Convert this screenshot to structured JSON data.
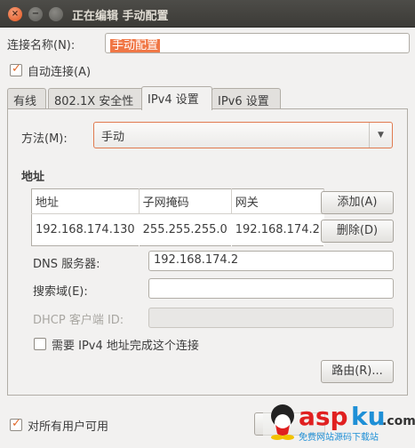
{
  "window": {
    "title": "正在编辑 手动配置"
  },
  "connection": {
    "name_label": "连接名称(N):",
    "name_value": "手动配置",
    "auto_connect_label": "自动连接(A)"
  },
  "tabs": [
    {
      "label": "有线"
    },
    {
      "label": "802.1X 安全性"
    },
    {
      "label": "IPv4 设置"
    },
    {
      "label": "IPv6 设置"
    }
  ],
  "ipv4": {
    "method_label": "方法(M):",
    "method_value": "手动",
    "addresses_heading": "地址",
    "columns": [
      "地址",
      "子网掩码",
      "网关"
    ],
    "rows": [
      [
        "192.168.174.130",
        "255.255.255.0",
        "192.168.174.2"
      ]
    ],
    "add_button": "添加(A)",
    "delete_button": "删除(D)",
    "dns_label": "DNS 服务器:",
    "dns_value": "192.168.174.2",
    "search_label": "搜索域(E):",
    "search_value": "",
    "dhcp_label": "DHCP 客户端 ID:",
    "dhcp_value": "",
    "require_ipv4_label": "需要 IPv4 地址完成这个连接",
    "routes_button": "路由(R)..."
  },
  "footer": {
    "all_users_label": "对所有用户可用"
  },
  "watermark": {
    "text": "aspku",
    "suffix": ".com",
    "subtext": "免费网站源码下载站"
  },
  "colors": {
    "accent": "#f07746",
    "titlebar": "#3c3b37",
    "window_bg": "#f2f1f0"
  }
}
